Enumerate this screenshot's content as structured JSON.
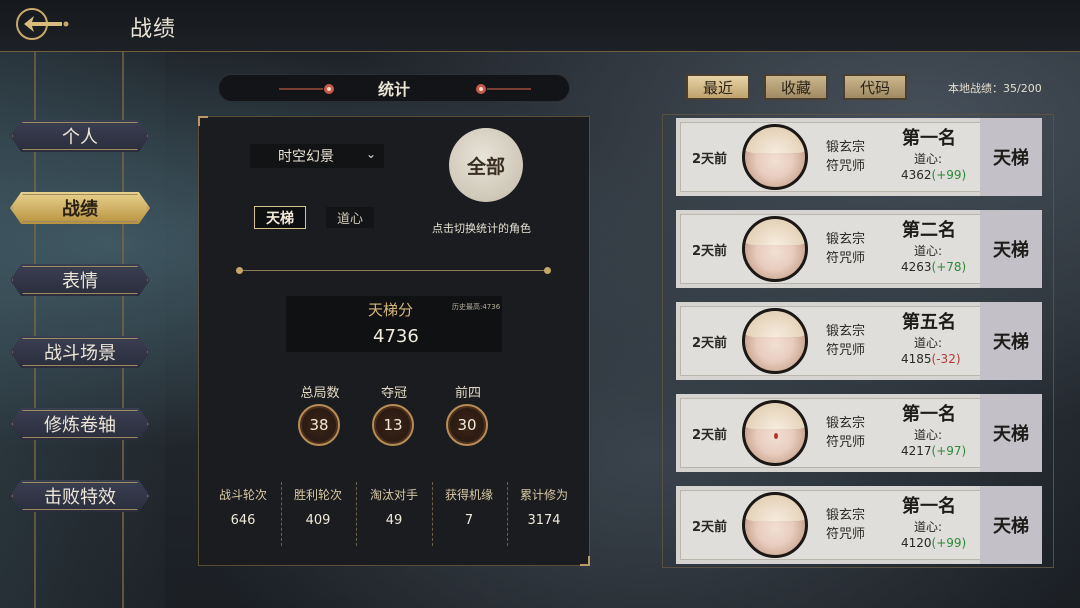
{
  "header": {
    "title": "战绩",
    "back_icon": "back-arrow-icon"
  },
  "menu": [
    {
      "label": "个人",
      "active": false
    },
    {
      "label": "战绩",
      "active": true
    },
    {
      "label": "表情",
      "active": false
    },
    {
      "label": "战斗场景",
      "active": false
    },
    {
      "label": "修炼卷轴",
      "active": false
    },
    {
      "label": "击败特效",
      "active": false
    }
  ],
  "stats": {
    "title": "统计",
    "mode_select": "时空幻景",
    "role_button": "全部",
    "role_hint": "点击切换统计的角色",
    "tabs": [
      "天梯",
      "道心"
    ],
    "score_label": "天梯分",
    "score_best": "历史最高:4736",
    "score_value": "4736",
    "rings": [
      {
        "label": "总局数",
        "value": "38"
      },
      {
        "label": "夺冠",
        "value": "13"
      },
      {
        "label": "前四",
        "value": "30"
      }
    ],
    "totals": [
      {
        "label": "战斗轮次",
        "value": "646"
      },
      {
        "label": "胜利轮次",
        "value": "409"
      },
      {
        "label": "淘汰对手",
        "value": "49"
      },
      {
        "label": "获得机缘",
        "value": "7"
      },
      {
        "label": "累计修为",
        "value": "3174"
      }
    ]
  },
  "history": {
    "tabs": [
      "最近",
      "收藏",
      "代码"
    ],
    "active_tab": "最近",
    "local_count": "本地战绩：35/200",
    "records": [
      {
        "time": "2天前",
        "sect": "锻玄宗",
        "role": "符咒师",
        "rank": "第一名",
        "dao_label": "道心:",
        "score": "4362",
        "delta": "(+99)",
        "mode": "天梯"
      },
      {
        "time": "2天前",
        "sect": "锻玄宗",
        "role": "符咒师",
        "rank": "第二名",
        "dao_label": "道心:",
        "score": "4263",
        "delta": "(+78)",
        "mode": "天梯"
      },
      {
        "time": "2天前",
        "sect": "锻玄宗",
        "role": "符咒师",
        "rank": "第五名",
        "dao_label": "道心:",
        "score": "4185",
        "delta": "(-32)",
        "mode": "天梯"
      },
      {
        "time": "2天前",
        "sect": "锻玄宗",
        "role": "符咒师",
        "rank": "第一名",
        "dao_label": "道心:",
        "score": "4217",
        "delta": "(+97)",
        "mode": "天梯"
      },
      {
        "time": "2天前",
        "sect": "锻玄宗",
        "role": "符咒师",
        "rank": "第一名",
        "dao_label": "道心:",
        "score": "4120",
        "delta": "(+99)",
        "mode": "天梯"
      }
    ]
  },
  "colors": {
    "accent_gold": "#c6a76a",
    "positive": "#2c8a3a",
    "negative": "#b53a34"
  }
}
